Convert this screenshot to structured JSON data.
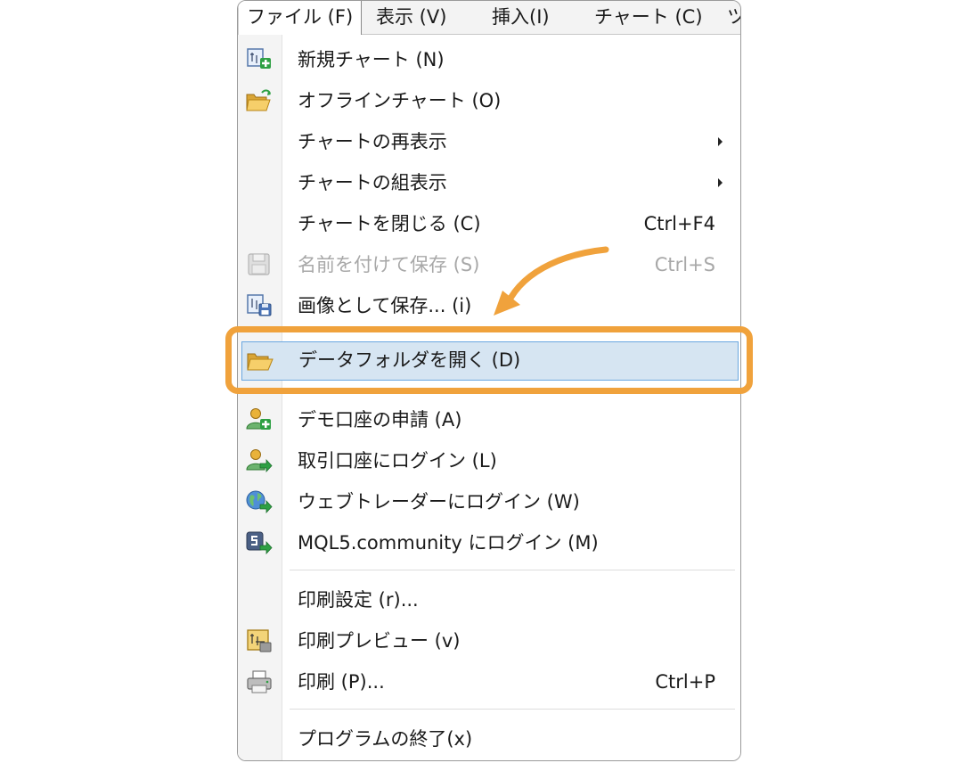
{
  "menubar": {
    "items": [
      {
        "label": "ファイル (F)",
        "active": true
      },
      {
        "label": "表示 (V)"
      },
      {
        "label": "挿入(I)"
      },
      {
        "label": "チャート (C)"
      },
      {
        "label": "ツ"
      }
    ]
  },
  "menu": {
    "items": [
      {
        "label": "新規チャート (N)",
        "icon": "new-chart-icon"
      },
      {
        "label": "オフラインチャート (O)",
        "icon": "offline-folder-icon"
      },
      {
        "label": "チャートの再表示",
        "submenu": true
      },
      {
        "label": "チャートの組表示",
        "submenu": true
      },
      {
        "label": "チャートを閉じる (C)",
        "shortcut": "Ctrl+F4"
      },
      {
        "label": "名前を付けて保存 (S)",
        "shortcut": "Ctrl+S",
        "disabled": true,
        "icon": "floppy-disk-icon"
      },
      {
        "label": "画像として保存... (i)",
        "icon": "save-image-icon"
      },
      {
        "label": "データフォルダを開く (D)",
        "icon": "open-folder-icon",
        "highlighted": true
      },
      {
        "label": "デモ口座の申請 (A)",
        "icon": "user-add-icon"
      },
      {
        "label": "取引口座にログイン (L)",
        "icon": "user-login-icon"
      },
      {
        "label": "ウェブトレーダーにログイン (W)",
        "icon": "globe-login-icon"
      },
      {
        "label": "MQL5.community にログイン (M)",
        "icon": "mql5-login-icon"
      },
      {
        "label": "印刷設定 (r)..."
      },
      {
        "label": "印刷プレビュー (v)",
        "icon": "print-preview-icon"
      },
      {
        "label": "印刷 (P)...",
        "shortcut": "Ctrl+P",
        "icon": "printer-icon"
      },
      {
        "label": "プログラムの終了(x)"
      }
    ]
  },
  "colors": {
    "highlight_fill": "#d6e5f2",
    "highlight_border": "#6aa7e0",
    "callout": "#f0a23c",
    "disabled_text": "#a8a8a8"
  }
}
